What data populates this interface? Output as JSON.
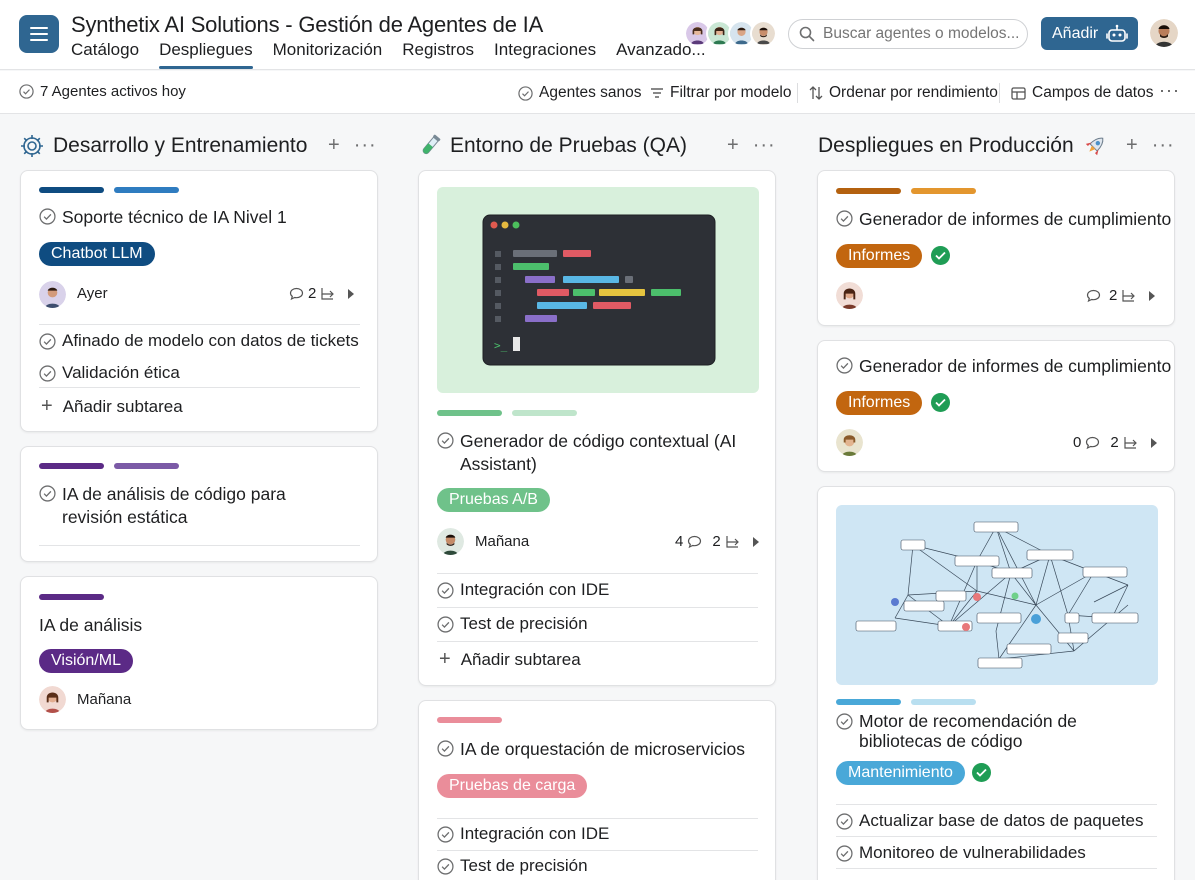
{
  "app": {
    "title": "Synthetix AI Solutions - Gestión de Agentes de IA"
  },
  "nav": {
    "tabs": [
      {
        "label": "Catálogo"
      },
      {
        "label": "Despliegues"
      },
      {
        "label": "Monitorización"
      },
      {
        "label": "Registros"
      },
      {
        "label": "Integraciones"
      },
      {
        "label": "Avanzado..."
      }
    ],
    "active_tab": "Despliegues"
  },
  "search": {
    "placeholder": "Buscar agentes o modelos..."
  },
  "header": {
    "add_label": "Añadir"
  },
  "toolbar": {
    "status": "7 Agentes activos hoy",
    "healthy": "Agentes sanos",
    "filter": "Filtrar por modelo",
    "sort": "Ordenar por rendimiento",
    "fields": "Campos de datos"
  },
  "colors": {
    "primary": "#2f6691",
    "blue_dark": "#0f4c81",
    "blue_mid": "#2f7cc0",
    "purple_dark": "#5b2a86",
    "purple_mid": "#7b5aa6",
    "green_light": "#6fc28a",
    "green_pale": "#bfe5cb",
    "orange_dark": "#b4610f",
    "orange_mid": "#e3962e",
    "pink": "#ea8d9a",
    "sky": "#49a8d8",
    "sky_pale": "#b9dff0",
    "ok": "#1f9d55"
  },
  "columns": [
    {
      "title": "Desarrollo y Entrenamiento",
      "icon": "gear-icon",
      "cards": [
        {
          "title": "Soporte técnico de IA Nivel 1",
          "tag": "Chatbot LLM",
          "date": "Ayer",
          "comments": "",
          "subtasks_count": "2",
          "subtasks": [
            "Afinado de modelo con datos de tickets",
            "Validación ética"
          ],
          "add_subtask": "Añadir subtarea"
        },
        {
          "title": "IA de análisis de código para revisión estática"
        },
        {
          "title": "IA de análisis",
          "tag": "Visión/ML",
          "date": "Mañana"
        }
      ]
    },
    {
      "title": "Entorno de Pruebas (QA)",
      "icon": "test-tube-icon",
      "cards": [
        {
          "image": "terminal-code-illustration",
          "title": "Generador de código contextual (AI Assistant)",
          "tag": "Pruebas A/B",
          "date": "Mañana",
          "comments": "4",
          "subtasks_count": "2",
          "subtasks": [
            "Integración con IDE",
            "Test de precisión"
          ],
          "add_subtask": "Añadir subtarea"
        },
        {
          "title": "IA de orquestación de microservicios",
          "tag": "Pruebas de carga",
          "subtasks": [
            "Integración con IDE",
            "Test de precisión"
          ]
        }
      ]
    },
    {
      "title": "Despliegues en Producción",
      "icon": "rocket-icon",
      "cards": [
        {
          "title": "Generador de informes de cumplimiento",
          "tag": "Informes",
          "comments": "",
          "subtasks_count": "2"
        },
        {
          "title": "Generador de informes de cumplimiento",
          "tag": "Informes",
          "comments": "0",
          "subtasks_count": "2"
        },
        {
          "image": "dependency-graph-illustration",
          "title": "Motor de recomendación de bibliotecas de código",
          "tag": "Mantenimiento",
          "subtasks": [
            "Actualizar base de datos de paquetes",
            "Monitoreo de vulnerabilidades"
          ]
        }
      ]
    }
  ]
}
